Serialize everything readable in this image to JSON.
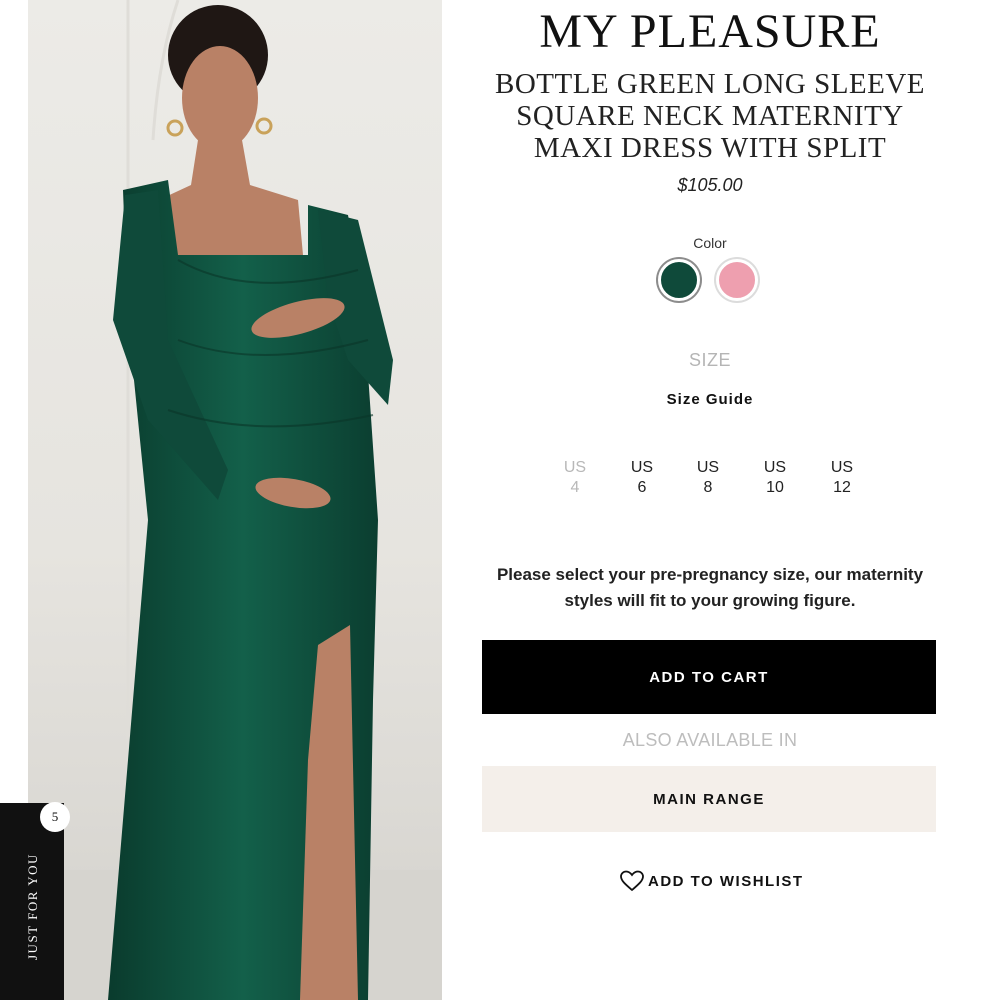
{
  "product": {
    "brand": "MY PLEASURE",
    "name": "BOTTLE GREEN LONG SLEEVE SQUARE NECK MATERNITY MAXI DRESS WITH SPLIT",
    "price": "$105.00",
    "image_icon": "model-in-green-dress-photo"
  },
  "color": {
    "label": "Color",
    "options": [
      {
        "name": "bottle-green",
        "hex": "#0f4a3a",
        "selected": true
      },
      {
        "name": "pink",
        "hex": "#ee9faf",
        "selected": false
      }
    ]
  },
  "size": {
    "label": "SIZE",
    "guide_label": "Size Guide",
    "options": [
      {
        "line1": "US",
        "line2": "4",
        "available": false
      },
      {
        "line1": "US",
        "line2": "6",
        "available": true
      },
      {
        "line1": "US",
        "line2": "8",
        "available": true
      },
      {
        "line1": "US",
        "line2": "10",
        "available": true
      },
      {
        "line1": "US",
        "line2": "12",
        "available": true
      }
    ]
  },
  "note": "Please select your pre-pregnancy size, our maternity styles will fit to your growing figure.",
  "actions": {
    "add_to_cart": "ADD TO CART",
    "also_available": "ALSO AVAILABLE IN",
    "main_range": "MAIN RANGE",
    "wishlist": "ADD TO WISHLIST",
    "wishlist_icon": "heart-icon"
  },
  "just_for_you": {
    "label": "JUST FOR YOU",
    "count": "5"
  }
}
